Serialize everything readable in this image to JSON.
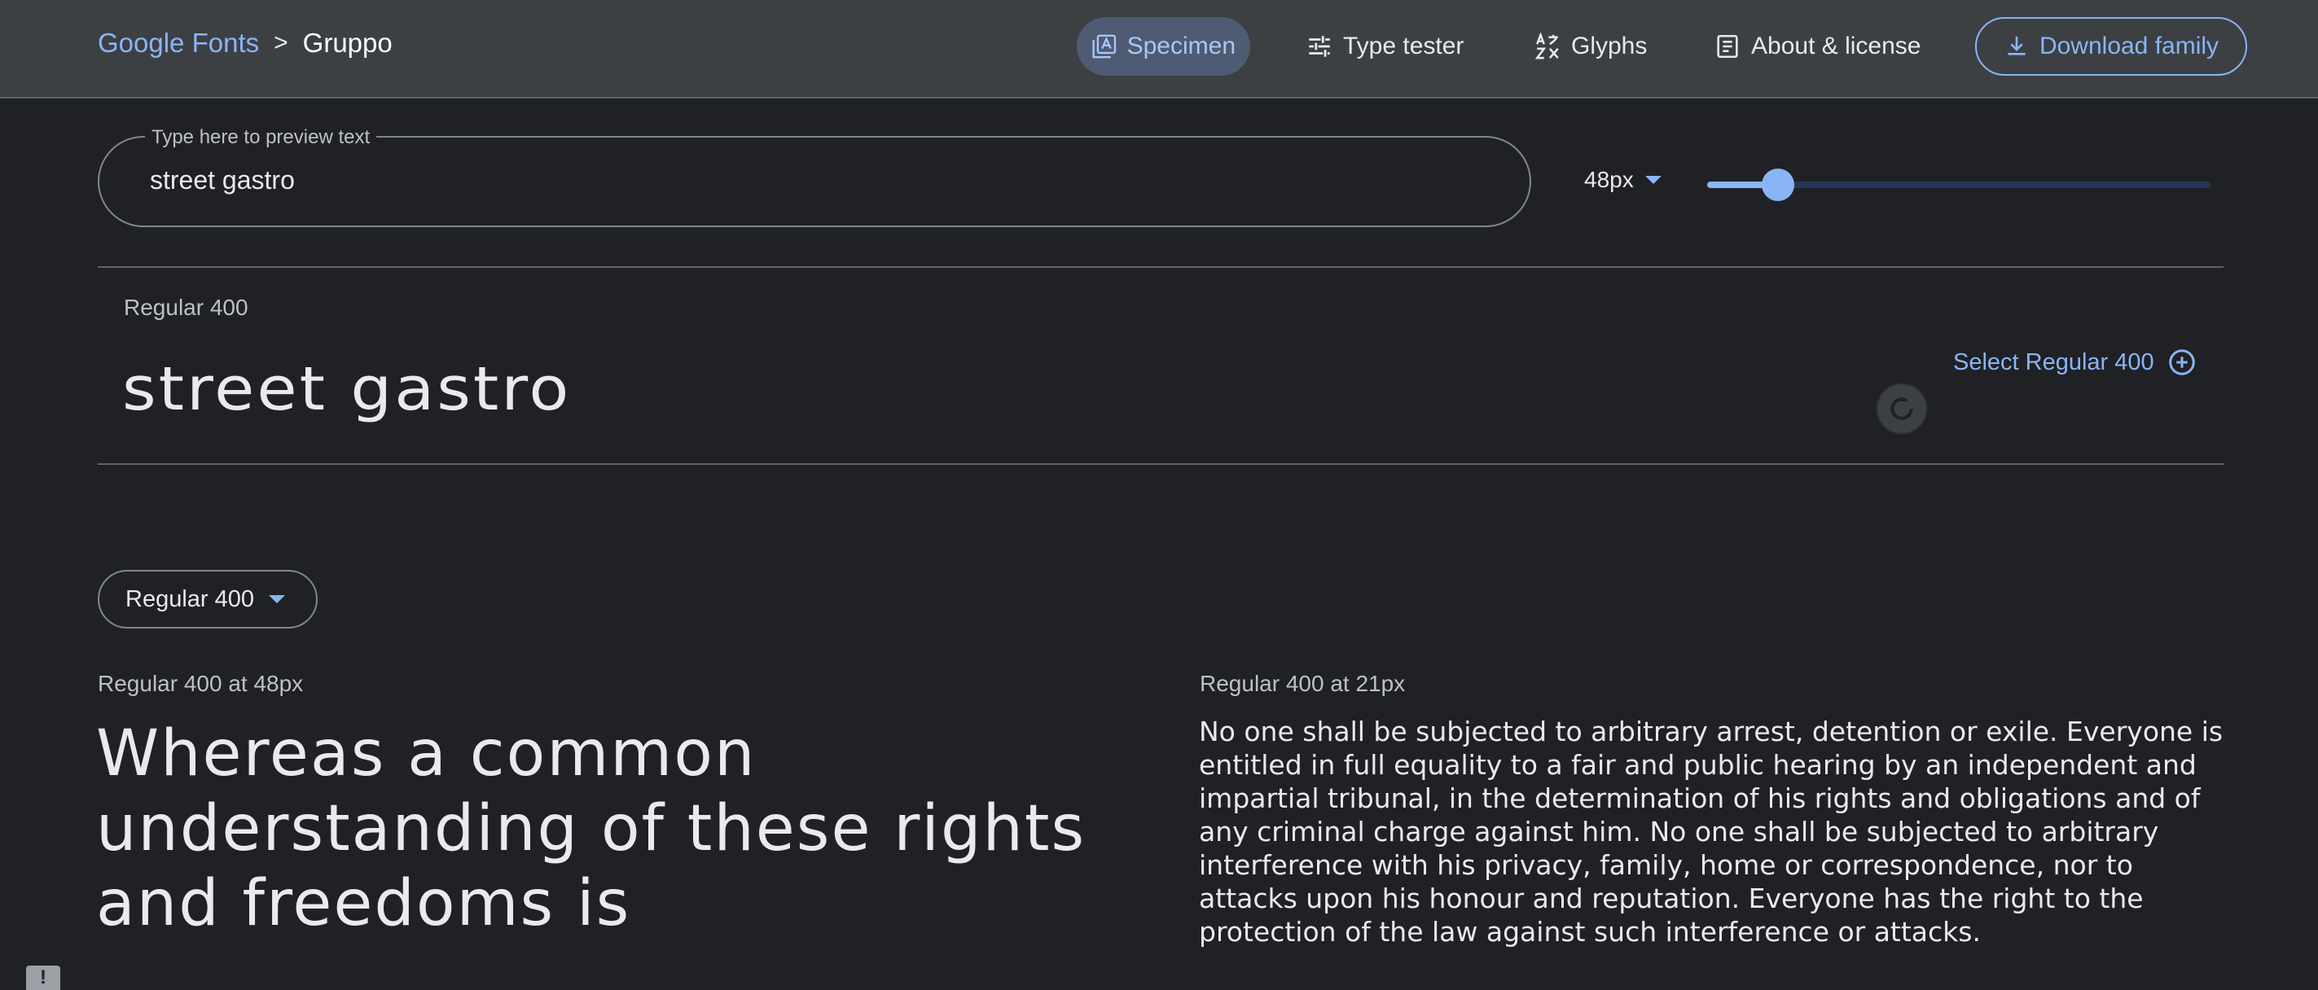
{
  "breadcrumb": {
    "root": "Google Fonts",
    "separator": ">",
    "current": "Gruppo"
  },
  "nav": {
    "specimen": "Specimen",
    "type_tester": "Type tester",
    "glyphs": "Glyphs",
    "about": "About & license",
    "download": "Download family"
  },
  "preview": {
    "label": "Type here to preview text",
    "value": "street gastro",
    "font_size": "48px",
    "slider_fraction": 0.14
  },
  "style_row": {
    "name": "Regular 400",
    "sample": "street gastro",
    "select_label": "Select Regular 400"
  },
  "weight_dropdown": "Regular 400",
  "samples": {
    "large_label": "Regular 400 at 48px",
    "large_text": "Whereas a common understanding of these rights and freedoms is",
    "small_label": "Regular 400 at 21px",
    "small_text": "No one shall be subjected to arbitrary arrest, detention or exile. Everyone is entitled in full equality to a fair and public hearing by an independent and impartial tribunal, in the determination of his rights and obligations and of any criminal charge against him. No one shall be subjected to arbitrary interference with his privacy, family, home or correspondence, nor to attacks upon his honour and reputation. Everyone has the right to the protection of the law against such interference or attacks."
  },
  "feedback_glyph": "!",
  "colors": {
    "accent": "#8ab4f8",
    "background": "#202124",
    "topbar": "#3c4043"
  }
}
